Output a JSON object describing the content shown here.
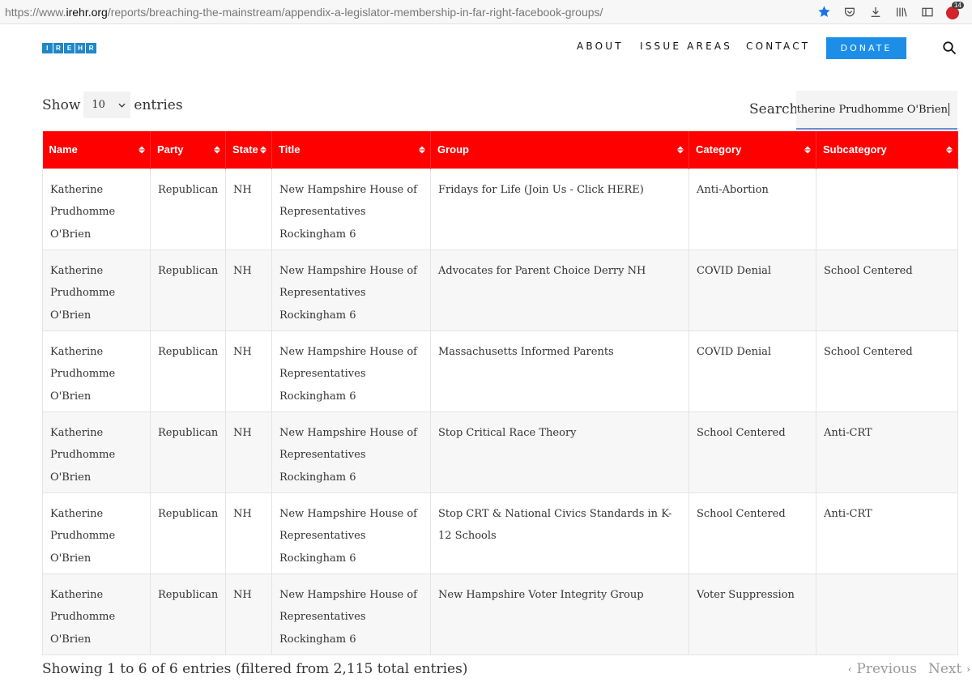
{
  "browser": {
    "url_prefix": "https://www.",
    "url_domain": "irehr.org",
    "url_path": "/reports/breaching-the-mainstream/appendix-a-legislator-membership-in-far-right-facebook-groups/",
    "extension_badge": "14"
  },
  "site": {
    "logo_letters": [
      "I",
      "R",
      "E",
      "H",
      "R"
    ],
    "nav": {
      "about": "ABOUT",
      "issue_areas": "ISSUE AREAS",
      "contact": "CONTACT"
    },
    "donate": "DONATE"
  },
  "controls": {
    "show_label": "Show",
    "entries_label": "entries",
    "page_length": "10",
    "search_label": "Search:",
    "search_value": "atherine Prudhomme O'Brien"
  },
  "table": {
    "columns": [
      "Name",
      "Party",
      "State",
      "Title",
      "Group",
      "Category",
      "Subcategory"
    ],
    "rows": [
      [
        "Katherine Prudhomme O'Brien",
        "Republican",
        "NH",
        "New Hampshire House of Representatives Rockingham 6",
        "Fridays for Life (Join Us - Click HERE)",
        "Anti-Abortion",
        ""
      ],
      [
        "Katherine Prudhomme O'Brien",
        "Republican",
        "NH",
        "New Hampshire House of Representatives Rockingham 6",
        "Advocates for Parent Choice Derry NH",
        "COVID Denial",
        "School Centered"
      ],
      [
        "Katherine Prudhomme O'Brien",
        "Republican",
        "NH",
        "New Hampshire House of Representatives Rockingham 6",
        "Massachusetts Informed Parents",
        "COVID Denial",
        "School Centered"
      ],
      [
        "Katherine Prudhomme O'Brien",
        "Republican",
        "NH",
        "New Hampshire House of Representatives Rockingham 6",
        "Stop Critical Race Theory",
        "School Centered",
        "Anti-CRT"
      ],
      [
        "Katherine Prudhomme O'Brien",
        "Republican",
        "NH",
        "New Hampshire House of Representatives Rockingham 6",
        "Stop CRT & National Civics Standards in K-12 Schools",
        "School Centered",
        "Anti-CRT"
      ],
      [
        "Katherine Prudhomme O'Brien",
        "Republican",
        "NH",
        "New Hampshire House of Representatives Rockingham 6",
        "New Hampshire Voter Integrity Group",
        "Voter Suppression",
        ""
      ]
    ]
  },
  "footer": {
    "info": "Showing 1 to 6 of 6 entries (filtered from 2,115 total entries)",
    "previous": "Previous",
    "next": "Next"
  },
  "colors": {
    "header_red": "#ff0000",
    "brand_blue": "#1e88c9",
    "donate_blue": "#1c8ee8"
  }
}
